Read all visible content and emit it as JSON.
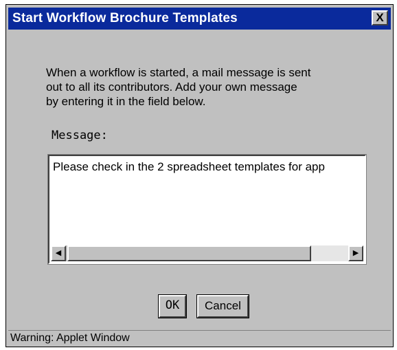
{
  "window": {
    "title": "Start Workflow Brochure Templates",
    "close_label": "X"
  },
  "description": {
    "lines": [
      "When a workflow is started, a mail message is sent",
      "out to all its contributors.  Add your own message",
      "by entering it in the field below."
    ]
  },
  "message": {
    "label": "Message:",
    "value": "Please check in the 2 spreadsheet templates for app"
  },
  "scrollbar": {
    "left_arrow": "◀",
    "right_arrow": "▶"
  },
  "buttons": {
    "ok": "OK",
    "cancel": "Cancel"
  },
  "status": {
    "text": "Warning: Applet Window"
  },
  "colors": {
    "titlebar": "#0a2a9c",
    "face": "#c0c0c0"
  }
}
